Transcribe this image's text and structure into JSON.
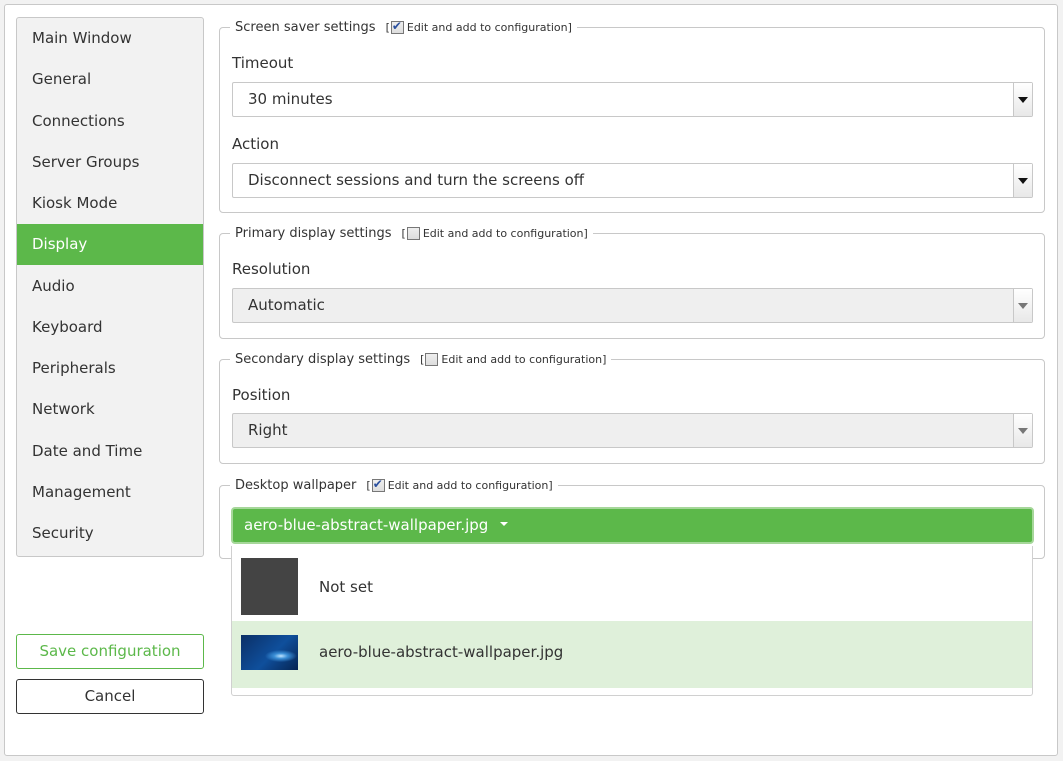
{
  "sidebar": {
    "items": [
      {
        "label": "Main Window",
        "active": false
      },
      {
        "label": "General",
        "active": false
      },
      {
        "label": "Connections",
        "active": false
      },
      {
        "label": "Server Groups",
        "active": false
      },
      {
        "label": "Kiosk Mode",
        "active": false
      },
      {
        "label": "Display",
        "active": true
      },
      {
        "label": "Audio",
        "active": false
      },
      {
        "label": "Keyboard",
        "active": false
      },
      {
        "label": "Peripherals",
        "active": false
      },
      {
        "label": "Network",
        "active": false
      },
      {
        "label": "Date and Time",
        "active": false
      },
      {
        "label": "Management",
        "active": false
      },
      {
        "label": "Security",
        "active": false
      }
    ],
    "save_label": "Save configuration",
    "cancel_label": "Cancel"
  },
  "colors": {
    "accent": "#5cb84a",
    "selected_option_bg": "#dff0da"
  },
  "sections": {
    "screensaver": {
      "title": "Screen saver settings",
      "edit_label": "Edit and add to configuration]",
      "edit_checked": true,
      "timeout_label": "Timeout",
      "timeout_value": "30 minutes",
      "action_label": "Action",
      "action_value": "Disconnect sessions and turn the screens off"
    },
    "primary": {
      "title": "Primary display settings",
      "edit_label": "Edit and add to configuration]",
      "edit_checked": false,
      "resolution_label": "Resolution",
      "resolution_value": "Automatic"
    },
    "secondary": {
      "title": "Secondary display settings",
      "edit_label": "Edit and add to configuration]",
      "edit_checked": false,
      "position_label": "Position",
      "position_value": "Right"
    },
    "wallpaper": {
      "title": "Desktop wallpaper",
      "edit_label": "Edit and add to configuration]",
      "edit_checked": true,
      "selected_value": "aero-blue-abstract-wallpaper.jpg",
      "options": [
        {
          "label": "Not set",
          "thumbnail": "dark-gray-swatch",
          "selected": false
        },
        {
          "label": "aero-blue-abstract-wallpaper.jpg",
          "thumbnail": "blue-abstract-image",
          "selected": true
        }
      ]
    }
  }
}
